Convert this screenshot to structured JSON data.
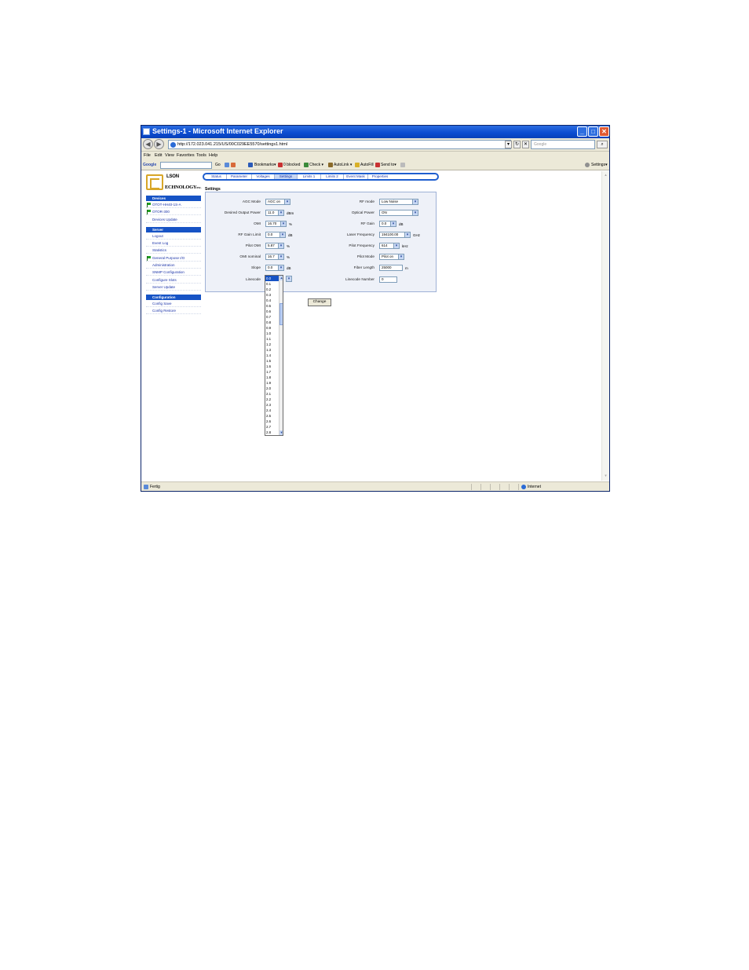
{
  "window": {
    "title": "Settings-1 - Microsoft Internet Explorer",
    "minimize": "_",
    "maximize": "□",
    "close": "✕"
  },
  "address": {
    "url": "http://172.023.041.215/US/00C029EE5570/settings1.html",
    "search_placeholder": "Google",
    "back": "◀",
    "forward": "▶",
    "go_arrow": "▾",
    "refresh": "↻",
    "stop": "✕",
    "search_go": "⌕"
  },
  "menu": [
    "File",
    "Edit",
    "View",
    "Favorites",
    "Tools",
    "Help"
  ],
  "google_toolbar": {
    "label": "Google",
    "go": "Go",
    "bookmarks": "Bookmarks▾",
    "blocked": "0 blocked",
    "check": "Check ▾",
    "autolink": "AutoLink ▾",
    "autofill": "AutoFill",
    "sendto": "Send to▾",
    "settings": "Settings▾"
  },
  "logo": {
    "line1": "LSON",
    "line2": "ECHNOLOGY",
    "suffix": "INC."
  },
  "sidebar": {
    "devices_header": "Devices",
    "devices": [
      "OTOT-HH40-1S-A",
      "OTOR-300"
    ],
    "devices_update": "Devices Update",
    "server_header": "Server",
    "server_items": [
      "Logout",
      "Event Log",
      "Statistics"
    ],
    "general_purpose": "General Purpose I/O",
    "server_items2": [
      "Administration",
      "SNMP Configuration",
      "Configure Slots",
      "Server Update"
    ],
    "config_header": "Configuration",
    "config_items": [
      "Config Save",
      "Config Restore"
    ]
  },
  "tabs": [
    "Status",
    "Parameter",
    "Voltages",
    "Settings",
    "Limits 1",
    "Limits 2",
    "Event Mask",
    "Properties"
  ],
  "active_tab": "Settings",
  "page_title": "Settings",
  "settings": {
    "left": [
      {
        "label": "AGC Mode",
        "value": "AGC on",
        "unit": ""
      },
      {
        "label": "Desired Output Power",
        "value": "11.0",
        "unit": "dBm"
      },
      {
        "label": "OMI",
        "value": "16.70",
        "unit": "%"
      },
      {
        "label": "RF Gain Limit",
        "value": "0.0",
        "unit": "dB"
      },
      {
        "label": "Pilot OMI",
        "value": "5.87",
        "unit": "%"
      },
      {
        "label": "OMI nominal",
        "value": "16.7",
        "unit": "%"
      },
      {
        "label": "Slope",
        "value": "0.0",
        "unit": "dB"
      },
      {
        "label": "Linecode",
        "value": "",
        "unit": ""
      }
    ],
    "right": [
      {
        "label": "RF mode",
        "value": "Low Noise",
        "unit": ""
      },
      {
        "label": "Optical Power",
        "value": "ON",
        "unit": ""
      },
      {
        "label": "RF Gain",
        "value": "0.0",
        "unit": "dB"
      },
      {
        "label": "Laser Frequency",
        "value": "194100.00",
        "unit": "GHz"
      },
      {
        "label": "Pilot Frequency",
        "value": "614",
        "unit": "kHz"
      },
      {
        "label": "Pilot Mode",
        "value": "Pilot on",
        "unit": ""
      },
      {
        "label": "Fiber Length",
        "value": "25000",
        "unit": "m"
      },
      {
        "label": "Linecode Number",
        "value": "0",
        "unit": ""
      }
    ],
    "dropdown_arrow": "▾"
  },
  "change_button": "Change",
  "slope_options": [
    "0.0",
    "0.1",
    "0.2",
    "0.3",
    "0.4",
    "0.5",
    "0.6",
    "0.7",
    "0.8",
    "0.9",
    "1.0",
    "1.1",
    "1.2",
    "1.3",
    "1.4",
    "1.5",
    "1.6",
    "1.7",
    "1.8",
    "1.9",
    "2.0",
    "2.1",
    "2.2",
    "2.3",
    "2.4",
    "2.5",
    "2.6",
    "2.7",
    "2.8",
    "2.9"
  ],
  "slope_selected": "0.0",
  "status": {
    "text": "Fertig",
    "zone": "Internet"
  },
  "colors": {
    "titlebar": "#0a4bd0",
    "sidebar_header": "#1653c5",
    "logo_gold": "#d8a628",
    "flag": "#22a022"
  }
}
